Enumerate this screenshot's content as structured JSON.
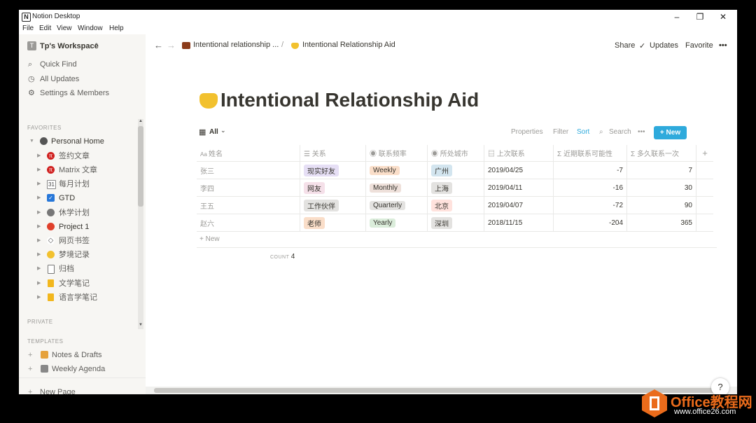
{
  "window": {
    "title": "Notion Desktop",
    "app_icon": "N"
  },
  "menu": [
    "File",
    "Edit",
    "View",
    "Window",
    "Help"
  ],
  "sidebar": {
    "workspace_badge": "T",
    "workspace": "Tp's Workspace",
    "quick_find": "Quick Find",
    "all_updates": "All Updates",
    "settings": "Settings & Members",
    "favorites_label": "FAVORITES",
    "personal_home": "Personal Home",
    "children": [
      {
        "label": "签约文章",
        "icon": "pi-icon"
      },
      {
        "label": "Matrix 文章",
        "icon": "pi-icon"
      },
      {
        "label": "每月计划",
        "icon": "calendar-icon"
      },
      {
        "label": "GTD",
        "icon": "checkbox-icon"
      },
      {
        "label": "休学计划",
        "icon": "cat-icon"
      },
      {
        "label": "Project 1",
        "icon": "project-icon"
      },
      {
        "label": "网页书签",
        "icon": "bookmark-icon"
      },
      {
        "label": "梦境记录",
        "icon": "sleepy-face-icon"
      },
      {
        "label": "归档",
        "icon": "archive-icon"
      },
      {
        "label": "文学笔记",
        "icon": "notebook-icon"
      },
      {
        "label": "语言学笔记",
        "icon": "notebook-icon"
      }
    ],
    "private_label": "PRIVATE",
    "templates_label": "TEMPLATES",
    "templates": [
      "Notes & Drafts",
      "Weekly Agenda"
    ],
    "new_page": "New Page"
  },
  "breadcrumb": [
    "Intentional relationship ...",
    "Intentional Relationship Aid"
  ],
  "topbar": {
    "share": "Share",
    "updates": "Updates",
    "favorite": "Favorite",
    "more": "•••"
  },
  "page": {
    "title": "Intentional Relationship Aid"
  },
  "toolbar": {
    "view": "All",
    "properties": "Properties",
    "filter": "Filter",
    "sort": "Sort",
    "search": "Search",
    "more": "•••",
    "new": "New"
  },
  "table": {
    "columns": [
      "姓名",
      "关系",
      "联系频率",
      "所处城市",
      "上次联系",
      "近期联系可能性",
      "多久联系一次"
    ],
    "rows": [
      {
        "name": "张三",
        "relation": "现实好友",
        "freq": "Weekly",
        "city": "广州",
        "last": "2019/04/25",
        "likelihood": "-7",
        "interval": "7"
      },
      {
        "name": "李四",
        "relation": "网友",
        "freq": "Monthly",
        "city": "上海",
        "last": "2019/04/11",
        "likelihood": "-16",
        "interval": "30"
      },
      {
        "name": "王五",
        "relation": "工作伙伴",
        "freq": "Quarterly",
        "city": "北京",
        "last": "2019/04/07",
        "likelihood": "-72",
        "interval": "90"
      },
      {
        "name": "赵六",
        "relation": "老师",
        "freq": "Yearly",
        "city": "深圳",
        "last": "2018/11/15",
        "likelihood": "-204",
        "interval": "365"
      }
    ],
    "new_label": "New",
    "count_label": "COUNT",
    "count": "4"
  },
  "help": "?",
  "watermark": {
    "title": "Office教程网",
    "url": "www.office26.com"
  }
}
